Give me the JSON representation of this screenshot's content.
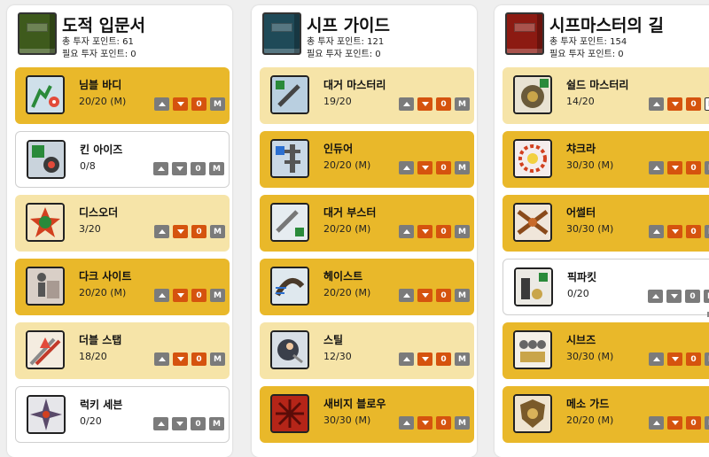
{
  "columns": [
    {
      "title": "도적 입문서",
      "invested": "총 투자 포인트: 61",
      "required": "필요 투자 포인트: 0",
      "book_color": "#3e5a1c",
      "skills": [
        {
          "name": "님블 바디",
          "level": "20/20 (M)",
          "value": "0",
          "icon": "nimble-body-icon"
        },
        {
          "name": "킨 아이즈",
          "level": "0/8",
          "value": "0",
          "icon": "keen-eyes-icon"
        },
        {
          "name": "디스오더",
          "level": "3/20",
          "value": "0",
          "icon": "disorder-icon"
        },
        {
          "name": "다크 사이트",
          "level": "20/20 (M)",
          "value": "0",
          "icon": "dark-sight-icon"
        },
        {
          "name": "더블 스탭",
          "level": "18/20",
          "value": "0",
          "icon": "double-stab-icon"
        },
        {
          "name": "럭키 세븐",
          "level": "0/20",
          "value": "0",
          "icon": "lucky-seven-icon"
        }
      ]
    },
    {
      "title": "시프 가이드",
      "invested": "총 투자 포인트: 121",
      "required": "필요 투자 포인트: 0",
      "book_color": "#1f4a58",
      "skills": [
        {
          "name": "대거 마스터리",
          "level": "19/20",
          "value": "0",
          "icon": "dagger-mastery-icon"
        },
        {
          "name": "인듀어",
          "level": "20/20 (M)",
          "value": "0",
          "icon": "endure-icon"
        },
        {
          "name": "대거 부스터",
          "level": "20/20 (M)",
          "value": "0",
          "icon": "dagger-booster-icon"
        },
        {
          "name": "헤이스트",
          "level": "20/20 (M)",
          "value": "0",
          "icon": "haste-icon"
        },
        {
          "name": "스틸",
          "level": "12/30",
          "value": "0",
          "icon": "steal-icon"
        },
        {
          "name": "새비지 블로우",
          "level": "30/30 (M)",
          "value": "0",
          "icon": "savage-blow-icon"
        }
      ]
    },
    {
      "title": "시프마스터의 길",
      "invested": "총 투자 포인트: 154",
      "required": "필요 투자 포인트: 0",
      "book_color": "#8c1a12",
      "skills": [
        {
          "name": "쉴드 마스터리",
          "level": "14/20",
          "value": "0",
          "icon": "shield-mastery-icon"
        },
        {
          "name": "챠크라",
          "level": "30/30 (M)",
          "value": "0",
          "icon": "chakra-icon"
        },
        {
          "name": "어썰터",
          "level": "30/30 (M)",
          "value": "0",
          "icon": "assaulter-icon"
        },
        {
          "name": "픽파킷",
          "level": "0/20",
          "value": "0",
          "icon": "pickpocket-icon"
        },
        {
          "name": "시브즈",
          "level": "30/30 (M)",
          "value": "0",
          "icon": "thieves-icon"
        },
        {
          "name": "메소 가드",
          "level": "20/20 (M)",
          "value": "0",
          "icon": "meso-guard-icon"
        }
      ]
    }
  ],
  "buttons": {
    "max_label": "M"
  }
}
